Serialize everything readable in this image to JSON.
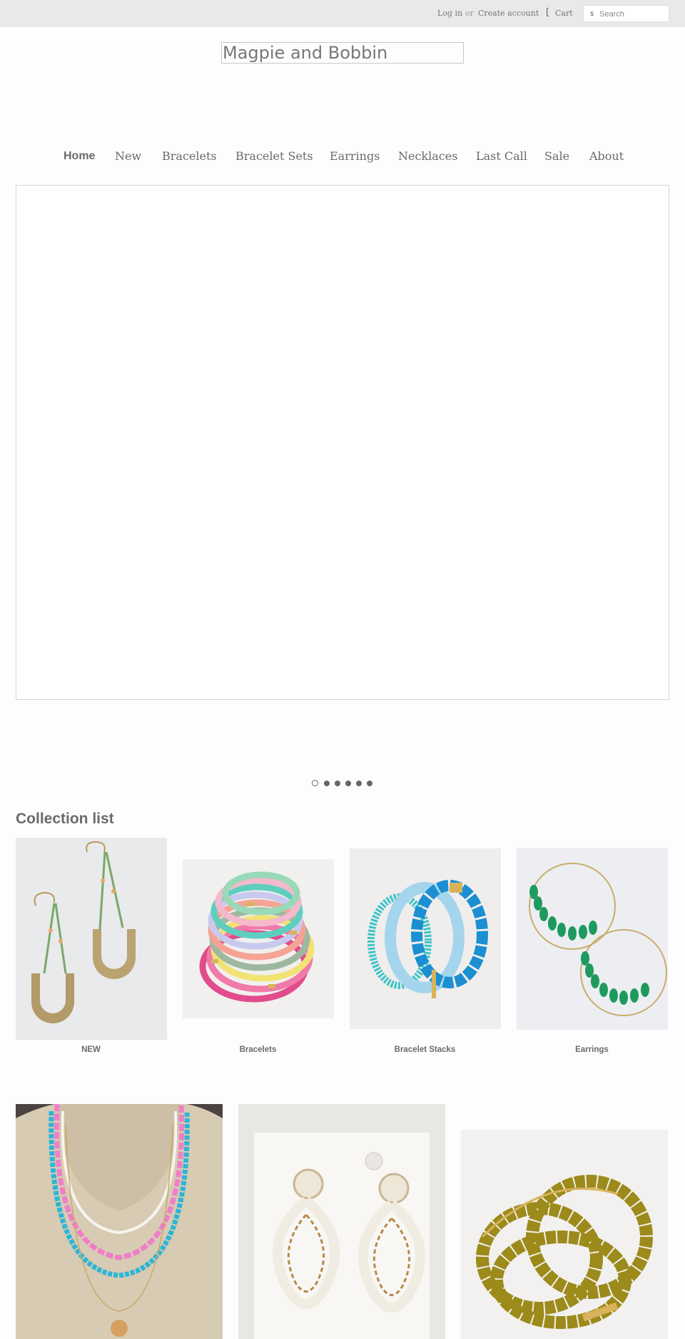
{
  "header": {
    "login": "Log in",
    "or": "or",
    "create_account": "Create account",
    "cart": "Cart",
    "search_placeholder": "Search",
    "search_icon_glyph": "s"
  },
  "logo": {
    "text": "Magpie and Bobbin"
  },
  "nav": {
    "items": [
      {
        "label": "Home"
      },
      {
        "label": "New"
      },
      {
        "label": "Bracelets"
      },
      {
        "label": "Bracelet Sets"
      },
      {
        "label": "Earrings"
      },
      {
        "label": "Necklaces"
      },
      {
        "label": "Last Call"
      },
      {
        "label": "Sale"
      },
      {
        "label": "About"
      }
    ]
  },
  "slideshow": {
    "slide_count": 6,
    "active_slide": 1
  },
  "collection": {
    "title": "Collection list",
    "cards": [
      {
        "label": "NEW",
        "icon": "gold-arch-earrings-photo"
      },
      {
        "label": "Bracelets",
        "icon": "stacked-tube-bracelets-photo"
      },
      {
        "label": "Bracelet Stacks",
        "icon": "blue-bracelet-stack-photo"
      },
      {
        "label": "Earrings",
        "icon": "green-bead-hoop-earrings-photo"
      },
      {
        "label": "",
        "icon": "layered-pink-blue-necklaces-photo"
      },
      {
        "label": "",
        "icon": "white-beaded-statement-earrings-photo"
      },
      {
        "label": "",
        "icon": "olive-glass-bead-bracelets-photo"
      }
    ]
  },
  "colors": {
    "topbar_bg": "#e9e9e9",
    "text": "#666666",
    "page_bg": "#fdfdfd"
  }
}
